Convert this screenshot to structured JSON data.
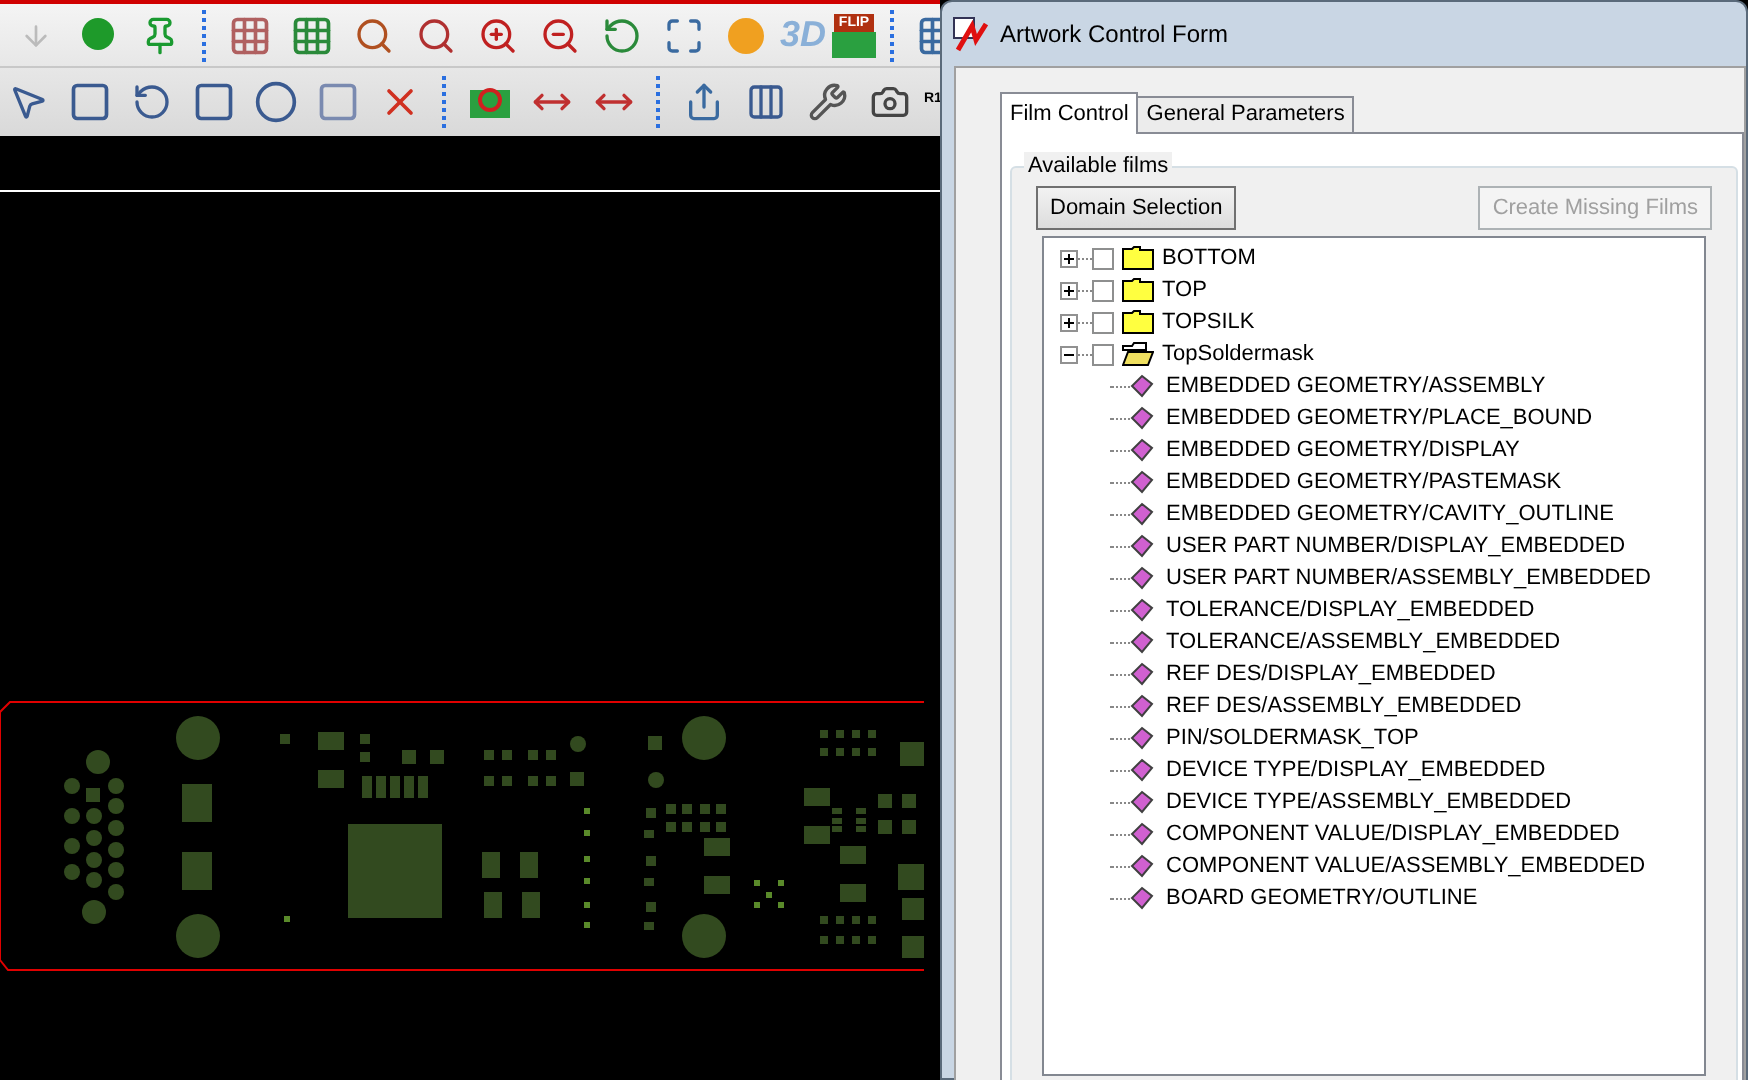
{
  "toolbar_labels": {
    "three_d": "3D",
    "flip": "FLIP",
    "r1": "R1"
  },
  "dialog": {
    "title": "Artwork Control Form",
    "tabs": [
      {
        "label": "Film Control",
        "selected": true
      },
      {
        "label": "General Parameters",
        "selected": false
      }
    ],
    "group_title": "Available films",
    "buttons": [
      {
        "label": "Domain Selection",
        "disabled": false
      },
      {
        "label": "Create Missing Films",
        "disabled": true
      }
    ],
    "films": [
      {
        "name": "BOTTOM",
        "expanded": false,
        "checked": false
      },
      {
        "name": "TOP",
        "expanded": false,
        "checked": false
      },
      {
        "name": "TOPSILK",
        "expanded": false,
        "checked": false
      },
      {
        "name": "TopSoldermask",
        "expanded": true,
        "checked": false,
        "children": [
          {
            "name": "EMBEDDED GEOMETRY/ASSEMBLY"
          },
          {
            "name": "EMBEDDED GEOMETRY/PLACE_BOUND"
          },
          {
            "name": "EMBEDDED GEOMETRY/DISPLAY"
          },
          {
            "name": "EMBEDDED GEOMETRY/PASTEMASK"
          },
          {
            "name": "EMBEDDED GEOMETRY/CAVITY_OUTLINE"
          },
          {
            "name": "USER PART NUMBER/DISPLAY_EMBEDDED"
          },
          {
            "name": "USER PART NUMBER/ASSEMBLY_EMBEDDED"
          },
          {
            "name": "TOLERANCE/DISPLAY_EMBEDDED"
          },
          {
            "name": "TOLERANCE/ASSEMBLY_EMBEDDED"
          },
          {
            "name": "REF DES/DISPLAY_EMBEDDED"
          },
          {
            "name": "REF DES/ASSEMBLY_EMBEDDED"
          },
          {
            "name": "PIN/SOLDERMASK_TOP"
          },
          {
            "name": "DEVICE TYPE/DISPLAY_EMBEDDED"
          },
          {
            "name": "DEVICE TYPE/ASSEMBLY_EMBEDDED"
          },
          {
            "name": "COMPONENT VALUE/DISPLAY_EMBEDDED"
          },
          {
            "name": "COMPONENT VALUE/ASSEMBLY_EMBEDDED"
          },
          {
            "name": "BOARD GEOMETRY/OUTLINE"
          }
        ]
      }
    ]
  }
}
